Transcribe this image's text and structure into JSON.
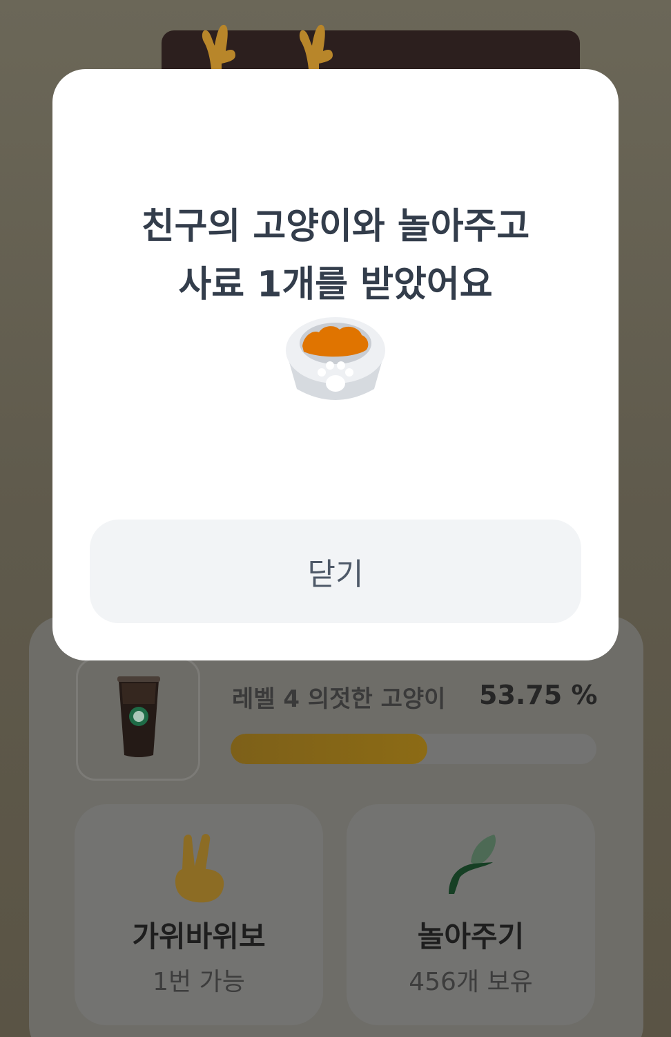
{
  "modal": {
    "title_line1": "친구의 고양이와 놀아주고",
    "title_line2": "사료 1개를 받았어요",
    "close_label": "닫기",
    "icon": "cat-food-bowl-icon"
  },
  "level": {
    "label": "레벨 4 의젓한 고양이",
    "percent_text": "53.75 %",
    "progress_fraction": 0.5375
  },
  "reward": {
    "icon": "iced-coffee-icon"
  },
  "actions": [
    {
      "icon": "victory-hand-icon",
      "title": "가위바위보",
      "subtitle": "1번 가능"
    },
    {
      "icon": "cat-teaser-icon",
      "title": "놀아주기",
      "subtitle": "456개 보유"
    }
  ],
  "colors": {
    "modal_bg": "#ffffff",
    "title_text": "#333d4b",
    "button_bg": "#f2f4f6",
    "food_orange": "#e07400"
  }
}
